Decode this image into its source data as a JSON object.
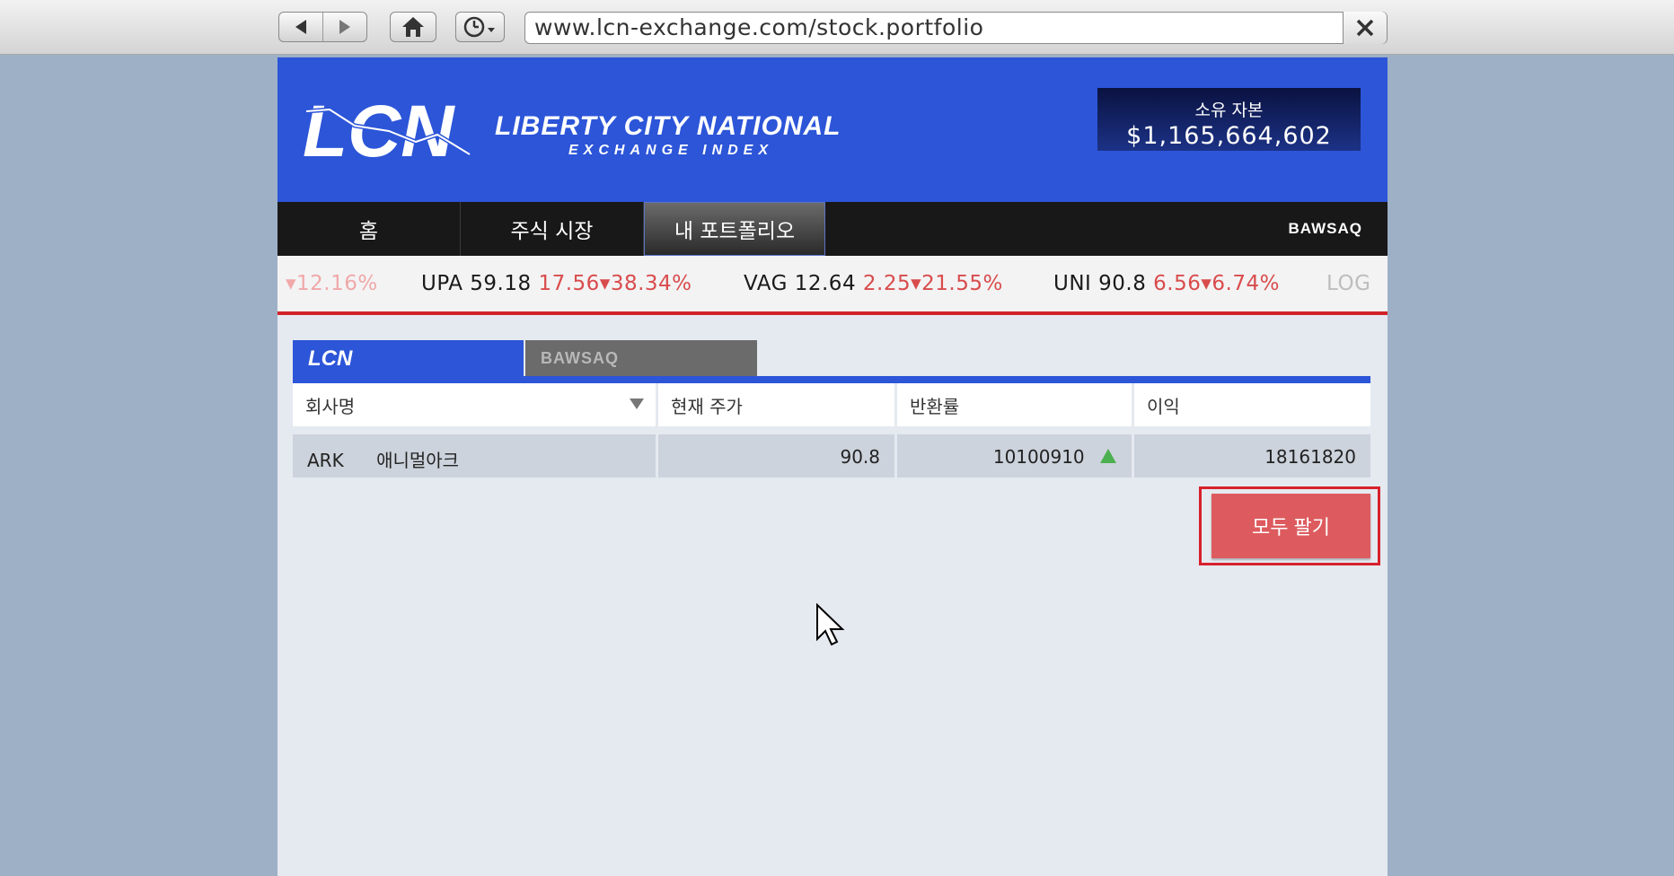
{
  "browser": {
    "url": "www.lcn-exchange.com/stock.portfolio",
    "back_icon": "back-arrow-icon",
    "forward_icon": "forward-arrow-icon",
    "home_icon": "home-icon",
    "history_icon": "clock-history-icon",
    "close_icon": "close-x-icon"
  },
  "header": {
    "logo_text": "LCN",
    "brand_title": "LIBERTY CITY NATIONAL",
    "brand_subtitle": "EXCHANGE INDEX",
    "capital_label": "소유 자본",
    "capital_value": "$1,165,664,602"
  },
  "nav": {
    "home": "홈",
    "market": "주식 시장",
    "portfolio": "내 포트폴리오",
    "bawsaq": "BAWSAQ"
  },
  "ticker": {
    "fade_start": "▾12.16%",
    "items": [
      {
        "symbol": "UPA",
        "price": "59.18",
        "change": "17.56▾38.34%"
      },
      {
        "symbol": "VAG",
        "price": "12.64",
        "change": "2.25▾21.55%"
      },
      {
        "symbol": "UNI",
        "price": "90.8",
        "change": "6.56▾6.74%"
      }
    ],
    "fade_end": "LOG"
  },
  "exchange_tabs": {
    "lcn": "LCN",
    "bawsaq": "BAWSAQ"
  },
  "table": {
    "headers": [
      "회사명",
      "현재 주가",
      "반환률",
      "이익"
    ],
    "rows": [
      {
        "ticker": "ARK",
        "company": "애니멀아크",
        "price": "90.8",
        "return": "10100910",
        "profit": "18161820"
      }
    ]
  },
  "actions": {
    "sell_all": "모두 팔기"
  },
  "colors": {
    "brand_blue": "#2c55d8",
    "nav_bg": "#181818",
    "ticker_red": "#d94c4c",
    "sell_button": "#dd5b5e",
    "highlight_outline": "#d7212c",
    "up_green": "#4caf50"
  }
}
